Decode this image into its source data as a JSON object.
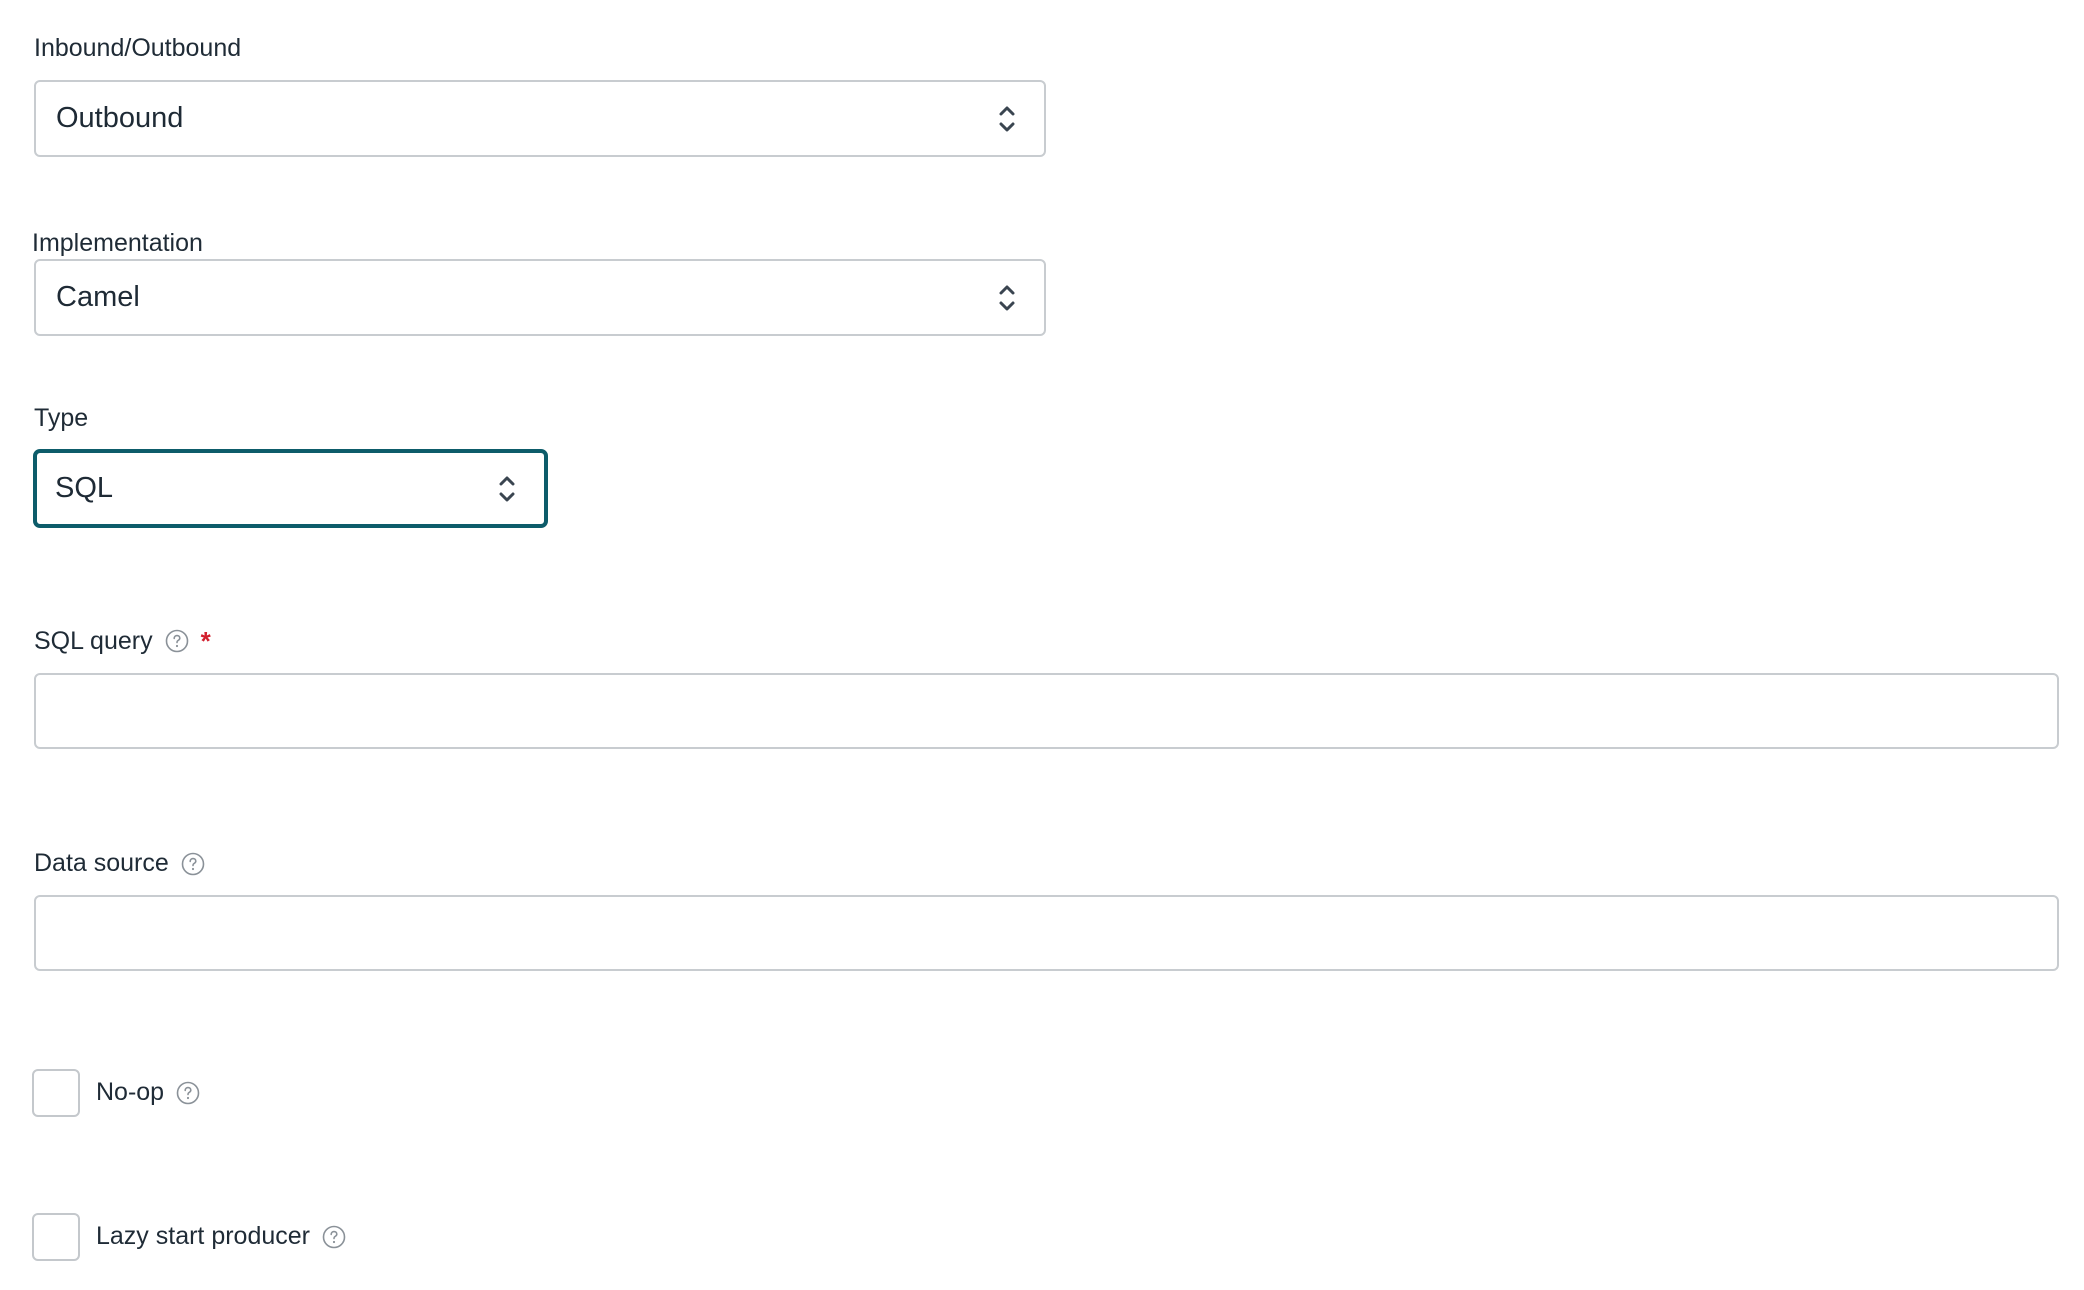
{
  "form": {
    "direction": {
      "label": "Inbound/Outbound",
      "value": "Outbound"
    },
    "implementation": {
      "label": "Implementation",
      "value": "Camel"
    },
    "type": {
      "label": "Type",
      "value": "SQL"
    },
    "sql_query": {
      "label": "SQL query",
      "required_mark": "*",
      "value": ""
    },
    "data_source": {
      "label": "Data source",
      "value": ""
    },
    "no_op": {
      "label": "No-op",
      "checked": false
    },
    "lazy_start_producer": {
      "label": "Lazy start producer",
      "checked": false
    }
  },
  "icons": {
    "help": "help-circle-icon",
    "select_arrows": "chevron-up-down-icon"
  },
  "colors": {
    "focus_border": "#0d5c6a",
    "required": "#d21f2d",
    "border": "#c8ccd0",
    "text": "#1f2b36"
  }
}
